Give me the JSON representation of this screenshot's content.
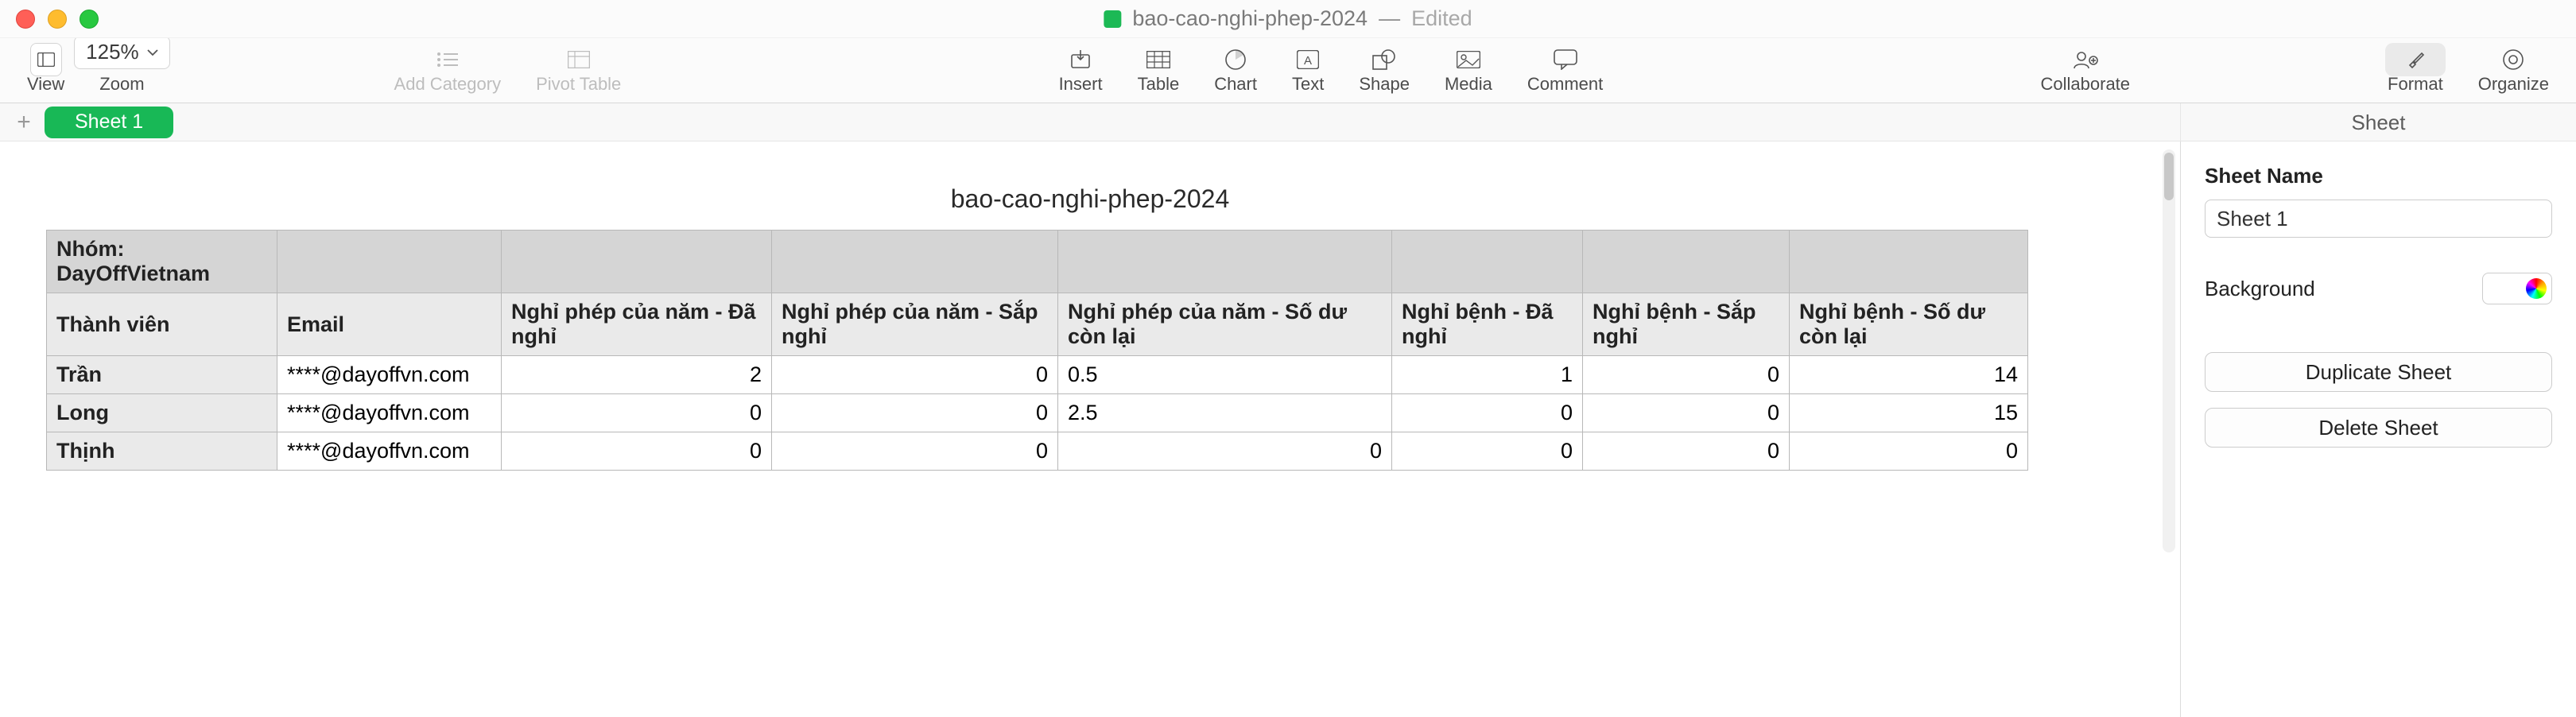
{
  "window": {
    "filename": "bao-cao-nghi-phep-2024",
    "status": "Edited"
  },
  "toolbar": {
    "view": "View",
    "zoom_value": "125%",
    "zoom_label": "Zoom",
    "add_category": "Add Category",
    "pivot_table": "Pivot Table",
    "insert": "Insert",
    "table": "Table",
    "chart": "Chart",
    "text": "Text",
    "shape": "Shape",
    "media": "Media",
    "comment": "Comment",
    "collaborate": "Collaborate",
    "format": "Format",
    "organize": "Organize"
  },
  "tabs": {
    "sheet1": "Sheet 1",
    "inspector_tab": "Sheet"
  },
  "table": {
    "title": "bao-cao-nghi-phep-2024",
    "group_label": "Nhóm: DayOffVietnam",
    "headers": {
      "member": "Thành viên",
      "email": "Email",
      "annual_taken": "Nghỉ phép của năm - Đã nghỉ",
      "annual_upcoming": "Nghỉ phép của năm - Sắp nghỉ",
      "annual_balance": "Nghỉ phép của năm - Số dư còn lại",
      "sick_taken": "Nghỉ bệnh - Đã nghỉ",
      "sick_upcoming": "Nghỉ bệnh - Sắp nghỉ",
      "sick_balance": "Nghỉ bệnh - Số dư còn lại"
    },
    "rows": [
      {
        "member": "Trần",
        "email": "****@dayoffvn.com",
        "annual_taken": "2",
        "annual_upcoming": "0",
        "annual_balance": "0.5",
        "sick_taken": "1",
        "sick_upcoming": "0",
        "sick_balance": "14"
      },
      {
        "member": "Long",
        "email": "****@dayoffvn.com",
        "annual_taken": "0",
        "annual_upcoming": "0",
        "annual_balance": "2.5",
        "sick_taken": "0",
        "sick_upcoming": "0",
        "sick_balance": "15"
      },
      {
        "member": "Thịnh",
        "email": "****@dayoffvn.com",
        "annual_taken": "0",
        "annual_upcoming": "0",
        "annual_balance": "0",
        "sick_taken": "0",
        "sick_upcoming": "0",
        "sick_balance": "0"
      }
    ]
  },
  "inspector": {
    "sheet_name_label": "Sheet Name",
    "sheet_name_value": "Sheet 1",
    "background_label": "Background",
    "duplicate": "Duplicate Sheet",
    "delete": "Delete Sheet"
  }
}
